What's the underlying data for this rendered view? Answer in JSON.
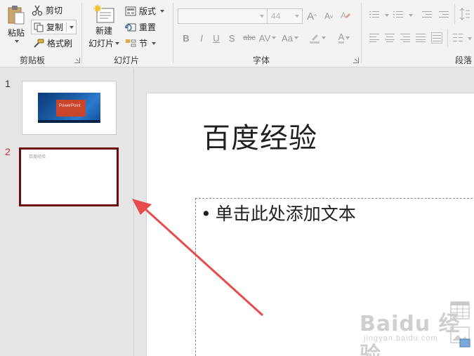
{
  "ribbon": {
    "clipboard": {
      "paste_label": "粘贴",
      "cut_label": "剪切",
      "copy_label": "复制",
      "format_painter_label": "格式刷",
      "group_label": "剪贴板"
    },
    "slides": {
      "new_slide_label_line1": "新建",
      "new_slide_label_line2": "幻灯片",
      "layout_label": "版式",
      "reset_label": "重置",
      "section_label": "节",
      "group_label": "幻灯片"
    },
    "font": {
      "font_name_value": "",
      "font_size_value": "44",
      "grow_label": "A",
      "shrink_label": "A",
      "bold_label": "B",
      "italic_label": "I",
      "underline_label": "U",
      "strike_label": "S",
      "shadow_label": "abc",
      "spacing_label": "AV",
      "case_label": "Aa",
      "color_label": "A",
      "group_label": "字体"
    },
    "paragraph": {
      "group_label": "段落"
    }
  },
  "slides_panel": {
    "slides": [
      {
        "number": "1",
        "thumb_title": "PowerPoint"
      },
      {
        "number": "2",
        "thumb_title": "百度经验"
      }
    ]
  },
  "editor": {
    "title": "百度经验",
    "bullet": "•",
    "body_placeholder": "单击此处添加文本"
  },
  "watermark": {
    "main": "Baidu 经验",
    "sub": "jingyan.baidu.com"
  },
  "colors": {
    "selected_slide_border": "#6b0c0c",
    "selected_slide_number": "#c4362f",
    "arrow": "#e84b4b",
    "thumb_accent": "#c8452b",
    "thumb_desktop": "#1d5fa8"
  }
}
